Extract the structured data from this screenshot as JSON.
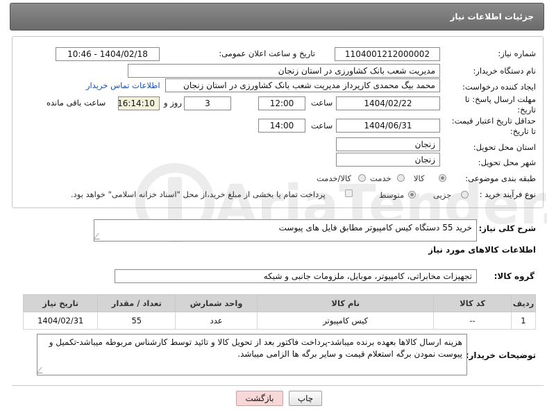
{
  "header": {
    "title": "جزئیات اطلاعات نیاز"
  },
  "form": {
    "need_number": {
      "label": "شماره نیاز:",
      "value": "1104001212000002"
    },
    "announce": {
      "label": "تاریخ و ساعت اعلان عمومی:",
      "value": "1404/02/18 - 10:46"
    },
    "buyer_org": {
      "label": "نام دستگاه خریدار:",
      "value": "مدیریت شعب بانک کشاورزی در استان زنجان"
    },
    "requester": {
      "label": "ایجاد کننده درخواست:",
      "value": "محمد بیگ محمدی کارپرداز مدیریت شعب بانک کشاورزی در استان زنجان",
      "contact_link": "اطلاعات تماس خریدار"
    },
    "reply_deadline": {
      "label_line1": "مهلت ارسال پاسخ: تا",
      "label_line2": "تاریخ:",
      "date": "1404/02/22",
      "time_label": "ساعت",
      "time": "12:00",
      "days": "3",
      "days_label": "روز و",
      "remaining": "16:14:10",
      "remaining_label": "ساعت باقی مانده"
    },
    "price_validity": {
      "label_line1": "حداقل تاریخ اعتبار قیمت:",
      "label_line2": "تا تاریخ:",
      "date": "1404/06/31",
      "time_label": "ساعت",
      "time": "14:00"
    },
    "delivery_province": {
      "label": "استان محل تحویل:",
      "value": "زنجان"
    },
    "delivery_city": {
      "label": "شهر محل تحویل:",
      "value": "زنجان"
    },
    "category": {
      "label": "طبقه بندی موضوعی:",
      "options": [
        "کالا",
        "خدمت",
        "کالا/خدمت"
      ],
      "selected": "کالا"
    },
    "purchase_type": {
      "label": "نوع فرآیند خرید :",
      "options": [
        "جزیی",
        "متوسط"
      ],
      "selected": "متوسط",
      "payment_note": "پرداخت تمام یا بخشی از مبلغ خرید،از محل \"اسناد خزانه اسلامی\" خواهد بود."
    }
  },
  "description": {
    "label": "شرح کلی نیاز:",
    "value": "خرید 55 دستگاه کیس کامپیوتر مطابق فایل های پیوست"
  },
  "goods_section": {
    "title": "اطلاعات کالاهای مورد نیاز"
  },
  "goods_group": {
    "label": "گروه کالا:",
    "value": "تجهیزات مخابراتی، کامپیوتر، موبایل، ملزومات جانبی و شبکه"
  },
  "table": {
    "headers": [
      "ردیف",
      "کد کالا",
      "نام کالا",
      "واحد شمارش",
      "تعداد / مقدار",
      "تاریخ نیاز"
    ],
    "rows": [
      [
        "1",
        "--",
        "کیس کامپیوتر",
        "عدد",
        "55",
        "1404/02/31"
      ]
    ]
  },
  "buyer_notes": {
    "label": "توضیحات خریدار:",
    "value": "هزینه ارسال کالاها بعهده برنده  میباشد-پرداخت فاکتور بعد از تحویل کالا و تائید توسط کارشناس مربوطه میباشد-تکمیل و پیوست نمودن برگه استعلام قیمت و سایر برگه ها الزامی میباشد."
  },
  "buttons": {
    "print": "چاپ",
    "back": "بازگشت"
  },
  "watermark": {
    "text": "AriaTender.neT"
  },
  "colors": {
    "header_bg": "#7a7a7a",
    "link": "#1a4fb5",
    "back_button": "#f7d7d7",
    "table_header": "#d4d4d4"
  }
}
